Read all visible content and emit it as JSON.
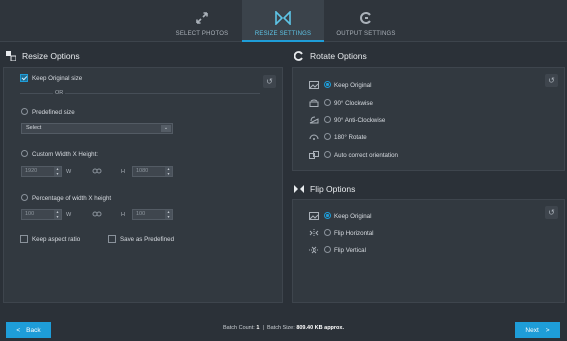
{
  "tabs": [
    {
      "label": "SELECT PHOTOS",
      "icon": "expand-arrows-icon",
      "active": false
    },
    {
      "label": "RESIZE SETTINGS",
      "icon": "resize-bowtie-icon",
      "active": true
    },
    {
      "label": "OUTPUT SETTINGS",
      "icon": "output-refresh-icon",
      "active": false
    }
  ],
  "resize": {
    "title": "Resize Options",
    "keep_original": "Keep Original size",
    "or": "OR",
    "predefined": "Predefined size",
    "select_value": "Select",
    "custom": "Custom Width X Height:",
    "width_value": "1920",
    "w_label": "W",
    "h_label": "H",
    "height_value": "1080",
    "percentage": "Percentage of width X height",
    "pct_w": "100",
    "pct_h": "100",
    "aspect": "Keep aspect ratio",
    "save_predefined": "Save as Predefined"
  },
  "rotate": {
    "title": "Rotate Options",
    "options": [
      "Keep Original",
      "90° Clockwise",
      "90° Anti-Clockwise",
      "180° Rotate",
      "Auto correct orientation"
    ]
  },
  "flip": {
    "title": "Flip Options",
    "options": [
      "Keep Original",
      "Flip Horizontal",
      "Flip Vertical"
    ]
  },
  "footer": {
    "back": "Back",
    "next": "Next",
    "batch_count_label": "Batch Count:",
    "batch_count": "1",
    "sep": "|",
    "batch_size_label": "Batch Size:",
    "batch_size": "809.40 KB approx."
  },
  "colors": {
    "accent": "#1e9dd8",
    "bg": "#2b3138",
    "panel": "#323940"
  }
}
